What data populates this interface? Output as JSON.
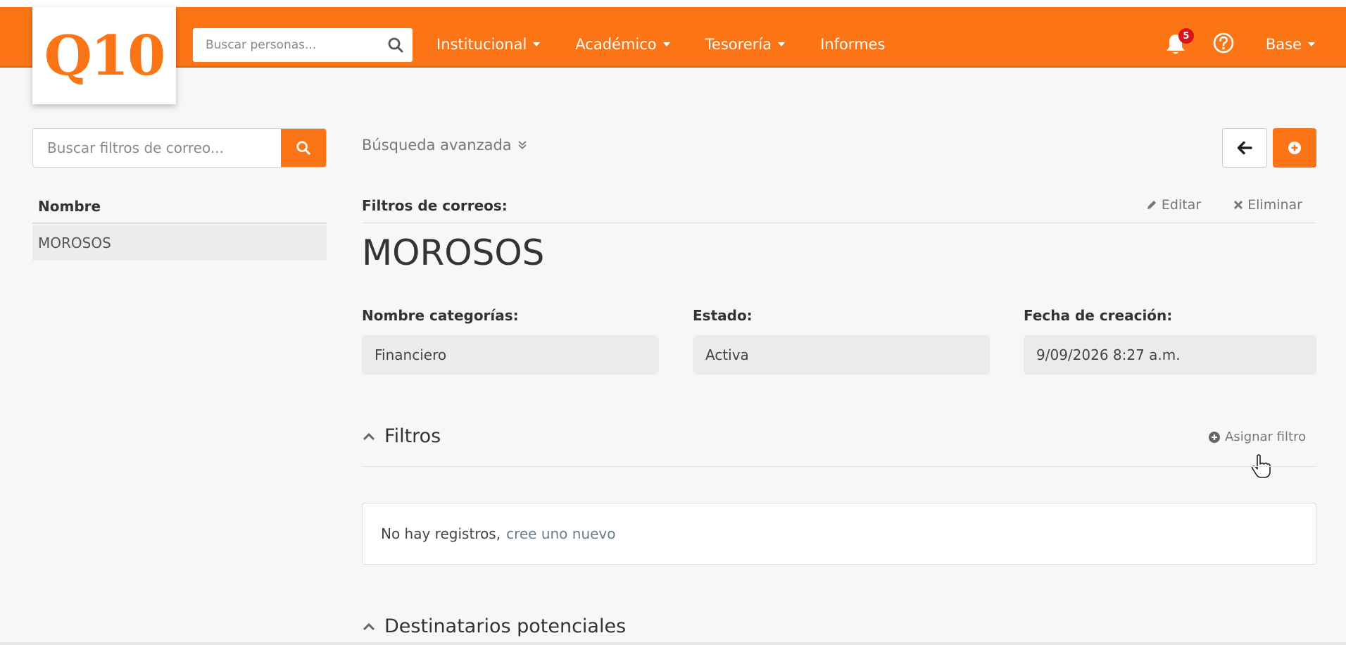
{
  "app": {
    "logo_text": "Q10",
    "brand_color": "#fb7517"
  },
  "navbar": {
    "search_placeholder": "Buscar personas...",
    "menu": [
      {
        "label": "Institucional",
        "has_dropdown": true
      },
      {
        "label": "Académico",
        "has_dropdown": true
      },
      {
        "label": "Tesorería",
        "has_dropdown": true
      },
      {
        "label": "Informes",
        "has_dropdown": false
      }
    ],
    "notification_count": "5",
    "user_label": "Base"
  },
  "sidebar": {
    "search_placeholder": "Buscar filtros de correo...",
    "column_header": "Nombre",
    "items": [
      {
        "label": "MOROSOS",
        "selected": true
      }
    ]
  },
  "main": {
    "advanced_search": "Búsqueda avanzada",
    "section_label": "Filtros de correos:",
    "edit_label": "Editar",
    "delete_label": "Eliminar",
    "record_title": "MOROSOS",
    "fields": [
      {
        "label": "Nombre categorías:",
        "value": "Financiero"
      },
      {
        "label": "Estado:",
        "value": "Activa"
      },
      {
        "label": "Fecha de creación:",
        "value": "9/09/2026 8:27 a.m."
      }
    ],
    "filters_section": {
      "title": "Filtros",
      "assign_label": "Asignar filtro",
      "empty_text": "No hay registros,",
      "empty_link": "cree uno nuevo"
    },
    "recipients_section": {
      "title": "Destinatarios potenciales"
    }
  }
}
